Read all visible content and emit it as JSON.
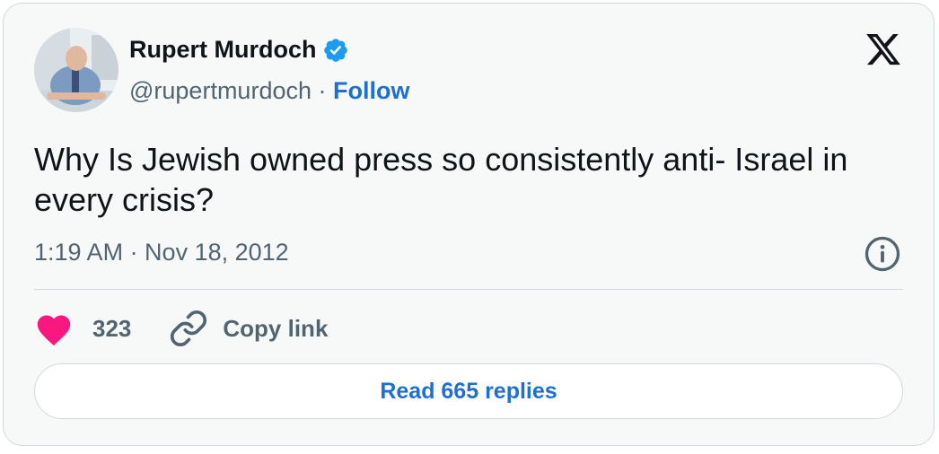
{
  "author": {
    "name": "Rupert Murdoch",
    "handle": "@rupertmurdoch",
    "separator": "·",
    "follow_label": "Follow",
    "verified": true,
    "avatar": "avatar-photo"
  },
  "tweet": {
    "text": "Why Is Jewish owned press so consistently anti- Israel in every crisis?",
    "timestamp": "1:19 AM · Nov 18, 2012"
  },
  "actions": {
    "like_count": "323",
    "copy_link_label": "Copy link"
  },
  "read_replies_label": "Read 665 replies",
  "icons": {
    "brand": "x-logo-icon",
    "verified": "verified-badge-icon",
    "info": "info-icon",
    "like": "heart-icon",
    "copy": "link-icon"
  },
  "colors": {
    "accent": "#1d6fd1",
    "verified": "#1d9bf0",
    "like": "#f91880",
    "text": "#0f1419",
    "muted": "#536471",
    "card_bg": "#f7f9f9",
    "border": "#cfd9de"
  }
}
